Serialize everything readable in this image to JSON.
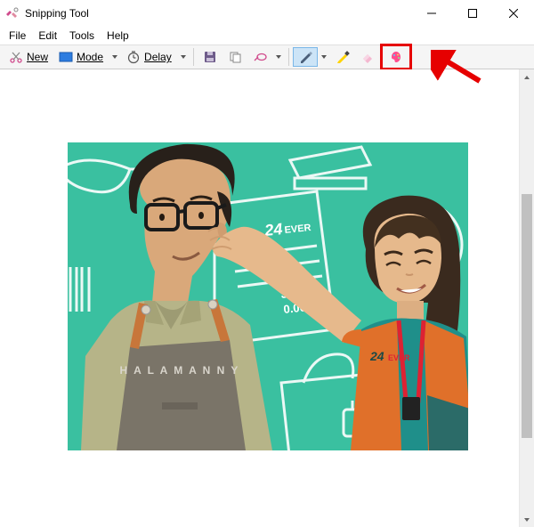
{
  "window": {
    "title": "Snipping Tool"
  },
  "menu": {
    "items": [
      "File",
      "Edit",
      "Tools",
      "Help"
    ]
  },
  "toolbar": {
    "new_label": "New",
    "mode_label": "Mode",
    "delay_label": "Delay"
  },
  "screenshot": {
    "apron_text": "HALAMANNY",
    "receipt_brand": "24EVER",
    "receipt_line1": "3.00",
    "receipt_line2": "0.00",
    "vest_logo": "24EVER"
  }
}
